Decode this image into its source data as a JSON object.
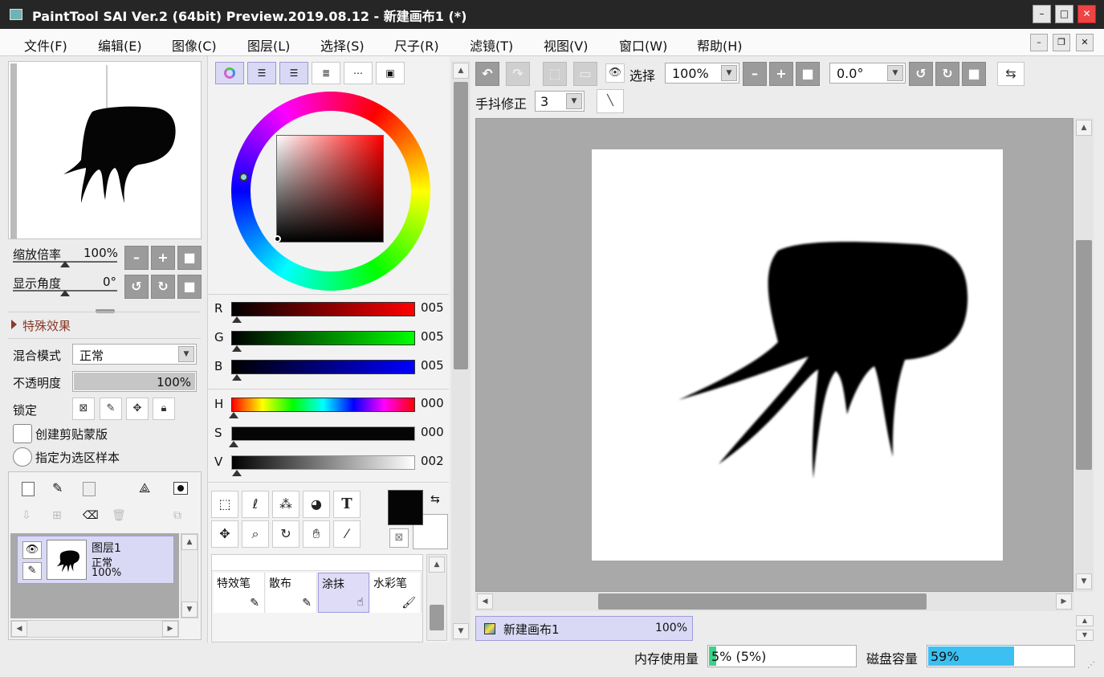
{
  "title": "PaintTool SAI Ver.2 (64bit) Preview.2019.08.12 - 新建画布1 (*)",
  "window_buttons": {
    "minimize": "–",
    "maximize": "□",
    "close": "✕"
  },
  "menu": [
    "文件(F)",
    "编辑(E)",
    "图像(C)",
    "图层(L)",
    "选择(S)",
    "尺子(R)",
    "滤镜(T)",
    "视图(V)",
    "窗口(W)",
    "帮助(H)"
  ],
  "navigator": {
    "zoom_label": "缩放倍率",
    "zoom_value": "100%",
    "zoom_slider": 0.5,
    "angle_label": "显示角度",
    "angle_value": "0°",
    "angle_slider": 0.5
  },
  "effects": {
    "label": "特殊效果"
  },
  "layer_props": {
    "blend_label": "混合模式",
    "blend_value": "正常",
    "opacity_label": "不透明度",
    "opacity_value": "100%",
    "opacity_fraction": 1.0,
    "lock_label": "锁定",
    "clip_label": "创建剪贴蒙版",
    "sample_label": "指定为选区样本"
  },
  "layers": [
    {
      "name": "图层1",
      "mode": "正常",
      "opacity": "100%"
    }
  ],
  "color": {
    "R": {
      "label": "R",
      "value": "005"
    },
    "G": {
      "label": "G",
      "value": "005"
    },
    "B": {
      "label": "B",
      "value": "005"
    },
    "H": {
      "label": "H",
      "value": "000"
    },
    "S": {
      "label": "S",
      "value": "000"
    },
    "V": {
      "label": "V",
      "value": "002"
    },
    "primary": "#050505",
    "secondary": "#ffffff"
  },
  "brushes": [
    "特效笔",
    "散布",
    "涂抹",
    "水彩笔"
  ],
  "toolbar": {
    "select_label": "选择",
    "zoom_value": "100%",
    "angle_value": "0.0°",
    "stabilizer_label": "手抖修正",
    "stabilizer_value": "3"
  },
  "canvas_tab": {
    "name": "新建画布1",
    "zoom": "100%"
  },
  "status": {
    "memory_label": "内存使用量",
    "memory_value": "5% (5%)",
    "memory_fraction": 0.05,
    "disk_label": "磁盘容量",
    "disk_value": "59%",
    "disk_fraction": 0.59
  },
  "colors": {
    "accent": "#dad9f5",
    "memory_bar": "#3cd28a",
    "disk_bar": "#3cc0f2",
    "canvas_bg": "#a9a9a9"
  }
}
